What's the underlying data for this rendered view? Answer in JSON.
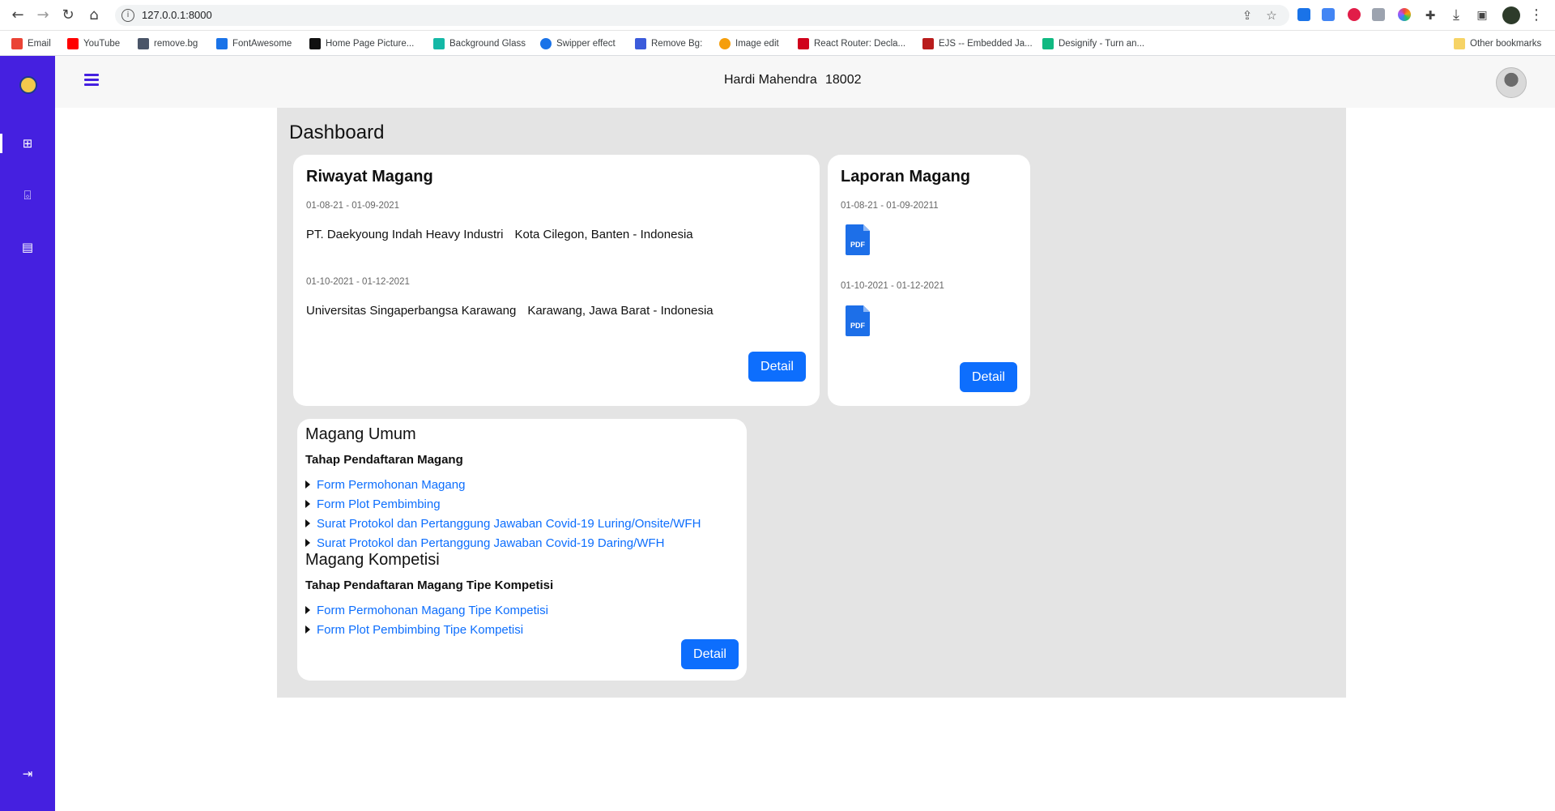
{
  "browser": {
    "url": "127.0.0.1:8000",
    "bookmarks": [
      {
        "label": "Email",
        "icon": "gmail-icon",
        "color": "#ea4335"
      },
      {
        "label": "YouTube",
        "icon": "youtube-icon",
        "color": "#ff0000"
      },
      {
        "label": "remove.bg",
        "icon": "removebg-icon",
        "color": "#4a5568"
      },
      {
        "label": "FontAwesome",
        "icon": "flag-icon",
        "color": "#1a73e8"
      },
      {
        "label": "Home Page Picture...",
        "icon": "home-icon",
        "color": "#111111"
      },
      {
        "label": "Background Glass",
        "icon": "glass-icon",
        "color": "#14b8a6"
      },
      {
        "label": "Swipper effect",
        "icon": "swiper-icon",
        "color": "#1a73e8"
      },
      {
        "label": "Remove Bg:",
        "icon": "triangle-icon",
        "color": "#3b5bdb"
      },
      {
        "label": "Image edit",
        "icon": "image-edit-icon",
        "color": "#f59e0b"
      },
      {
        "label": "React Router: Decla...",
        "icon": "react-router-icon",
        "color": "#d0021b"
      },
      {
        "label": "EJS -- Embedded Ja...",
        "icon": "ejs-icon",
        "color": "#b91c1c"
      },
      {
        "label": "Designify - Turn an...",
        "icon": "sparkle-icon",
        "color": "#10b981"
      }
    ],
    "other_bookmarks": "Other bookmarks"
  },
  "header": {
    "user_name": "Hardi Mahendra",
    "user_nim": "18002"
  },
  "sidebar": {
    "items": [
      {
        "icon": "dashboard-icon"
      },
      {
        "icon": "internship-icon"
      },
      {
        "icon": "report-icon"
      }
    ],
    "logout_icon": "logout-icon"
  },
  "page": {
    "title": "Dashboard"
  },
  "riwayat": {
    "title": "Riwayat Magang",
    "entries": [
      {
        "date": "01-08-21 - 01-09-2021",
        "company": "PT. Daekyoung Indah Heavy Industri",
        "location": "Kota Cilegon, Banten - Indonesia"
      },
      {
        "date": "01-10-2021 - 01-12-2021",
        "company": "Universitas Singaperbangsa Karawang",
        "location": "Karawang, Jawa Barat - Indonesia"
      }
    ],
    "button": "Detail"
  },
  "laporan": {
    "title": "Laporan Magang",
    "entries": [
      {
        "date": "01-08-21 - 01-09-20211",
        "file_label": "PDF"
      },
      {
        "date": "01-10-2021 - 01-12-2021",
        "file_label": "PDF"
      }
    ],
    "button": "Detail"
  },
  "magang": {
    "umum_title": "Magang Umum",
    "umum_sub": "Tahap Pendaftaran Magang",
    "umum_links": [
      "Form Permohonan Magang",
      "Form Plot Pembimbing",
      "Surat Protokol dan Pertanggung Jawaban Covid-19 Luring/Onsite/WFH",
      "Surat Protokol dan Pertanggung Jawaban Covid-19 Daring/WFH"
    ],
    "kompetisi_title": "Magang Kompetisi",
    "kompetisi_sub": "Tahap Pendaftaran Magang Tipe Kompetisi",
    "kompetisi_links": [
      "Form Permohonan Magang Tipe Kompetisi",
      "Form Plot Pembimbing Tipe Kompetisi"
    ],
    "button": "Detail"
  },
  "colors": {
    "sidebar": "#4520e0",
    "primary_button": "#0d6efd",
    "link": "#0d6efd",
    "content_bg": "#e4e4e4"
  }
}
